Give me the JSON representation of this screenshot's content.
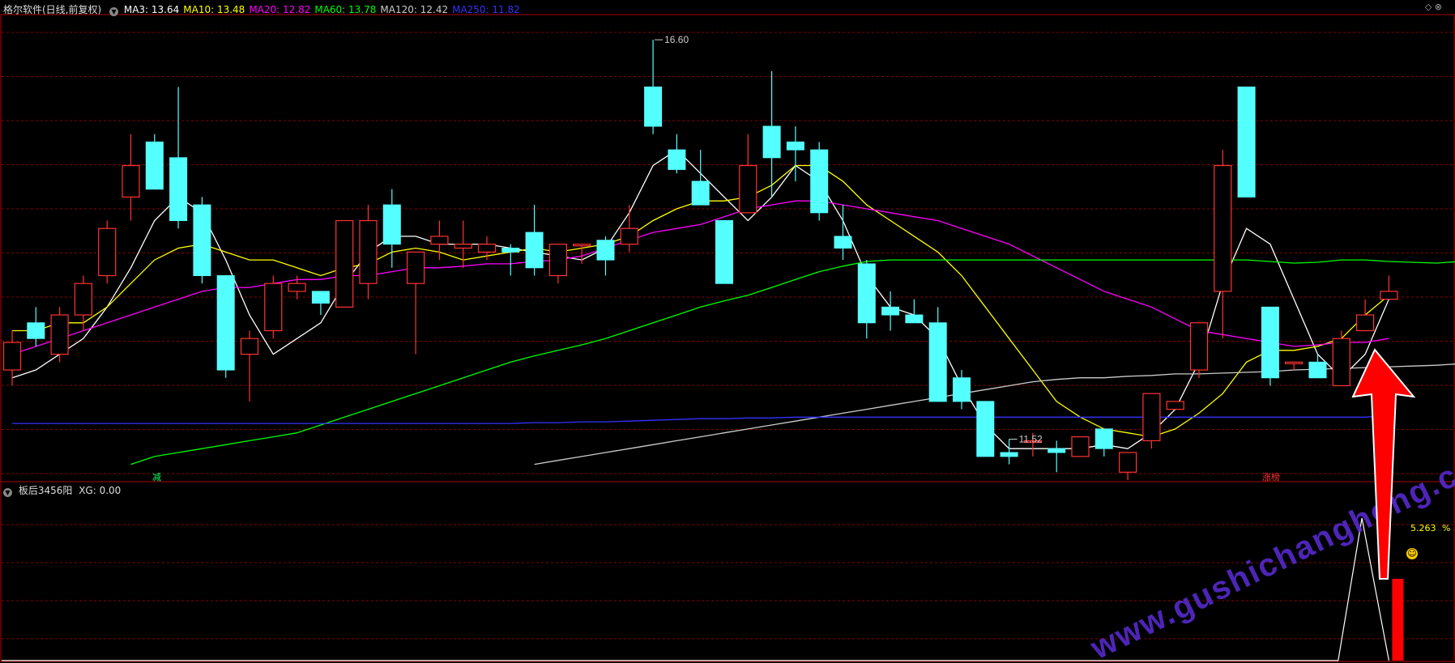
{
  "header": {
    "title": "格尔软件(日线,前复权)",
    "ma": [
      {
        "label": "MA3: 13.64",
        "color": "#ffffff"
      },
      {
        "label": "MA10: 13.48",
        "color": "#ffff00"
      },
      {
        "label": "MA20: 12.82",
        "color": "#ff00ff"
      },
      {
        "label": "MA60: 13.78",
        "color": "#00ff00"
      },
      {
        "label": "MA120: 12.42",
        "color": "#cccccc"
      },
      {
        "label": "MA250: 11.82",
        "color": "#3333ff"
      }
    ]
  },
  "sub_header": {
    "title": "板后3456阳",
    "xg": "XG: 0.00"
  },
  "markers": {
    "jian": "减",
    "zhangting": "涨榜"
  },
  "sub_value": "5.263",
  "sub_unit": "%",
  "watermark": "www.gushichanghong.com",
  "colors": {
    "up": "#ff3333",
    "down": "#54ffff",
    "grid": "#8a0000",
    "border": "#b00000"
  },
  "chart_data": {
    "type": "candlestick",
    "ylim": [
      11.0,
      16.9
    ],
    "annotations": {
      "high": {
        "value": 16.6,
        "label": "16.60"
      },
      "low": {
        "value": 11.52,
        "label": "11.52"
      }
    },
    "candles": [
      [
        12.4,
        12.9,
        12.2,
        12.75
      ],
      [
        13.0,
        13.2,
        12.7,
        12.8
      ],
      [
        12.6,
        13.2,
        12.5,
        13.1
      ],
      [
        13.1,
        13.6,
        12.9,
        13.5
      ],
      [
        13.6,
        14.3,
        13.5,
        14.2
      ],
      [
        14.6,
        15.4,
        14.3,
        15.0
      ],
      [
        15.3,
        15.4,
        14.7,
        14.7
      ],
      [
        15.1,
        16.0,
        14.2,
        14.3
      ],
      [
        14.5,
        14.6,
        13.5,
        13.6
      ],
      [
        13.6,
        13.6,
        12.3,
        12.4
      ],
      [
        12.6,
        12.9,
        12.0,
        12.8
      ],
      [
        12.9,
        13.6,
        12.8,
        13.5
      ],
      [
        13.4,
        13.6,
        13.3,
        13.5
      ],
      [
        13.4,
        13.4,
        13.1,
        13.25
      ],
      [
        13.2,
        14.1,
        13.2,
        14.3
      ],
      [
        13.5,
        14.5,
        13.3,
        14.3
      ],
      [
        14.5,
        14.7,
        13.7,
        14.0
      ],
      [
        13.5,
        13.9,
        12.6,
        13.9
      ],
      [
        14.0,
        14.3,
        13.8,
        14.1
      ],
      [
        13.95,
        14.3,
        13.7,
        14.0
      ],
      [
        13.9,
        14.1,
        13.8,
        14.0
      ],
      [
        13.95,
        14.0,
        13.6,
        13.9
      ],
      [
        14.15,
        14.5,
        13.6,
        13.7
      ],
      [
        13.6,
        14.0,
        13.5,
        14.0
      ],
      [
        14.0,
        14.0,
        13.75,
        14.0
      ],
      [
        14.05,
        14.1,
        13.6,
        13.8
      ],
      [
        14.0,
        14.5,
        13.9,
        14.2
      ],
      [
        16.0,
        16.6,
        15.4,
        15.5
      ],
      [
        15.2,
        15.4,
        14.9,
        14.95
      ],
      [
        14.8,
        15.2,
        14.5,
        14.5
      ],
      [
        14.3,
        14.3,
        13.5,
        13.5
      ],
      [
        14.4,
        15.4,
        14.4,
        15.0
      ],
      [
        15.5,
        16.2,
        14.6,
        15.1
      ],
      [
        15.3,
        15.5,
        14.8,
        15.2
      ],
      [
        15.2,
        15.3,
        14.3,
        14.4
      ],
      [
        14.1,
        14.5,
        13.8,
        13.95
      ],
      [
        13.75,
        13.8,
        12.8,
        13.0
      ],
      [
        13.2,
        13.4,
        12.9,
        13.1
      ],
      [
        13.1,
        13.3,
        13.0,
        13.0
      ],
      [
        13.0,
        13.2,
        12.5,
        12.0
      ],
      [
        12.3,
        12.4,
        11.9,
        12.0
      ],
      [
        12.0,
        12.0,
        11.3,
        11.3
      ],
      [
        11.35,
        11.52,
        11.2,
        11.3
      ],
      [
        11.5,
        11.6,
        11.3,
        11.5
      ],
      [
        11.4,
        11.5,
        11.1,
        11.35
      ],
      [
        11.3,
        11.5,
        11.3,
        11.55
      ],
      [
        11.65,
        11.6,
        11.3,
        11.4
      ],
      [
        11.1,
        11.3,
        11.0,
        11.35
      ],
      [
        11.5,
        12.1,
        11.4,
        12.1
      ],
      [
        11.9,
        12.0,
        11.9,
        12.0
      ],
      [
        12.4,
        13.0,
        12.3,
        13.0
      ],
      [
        13.4,
        15.2,
        12.8,
        15.0
      ],
      [
        16.0,
        16.0,
        14.6,
        14.6
      ],
      [
        13.2,
        13.1,
        12.2,
        12.3
      ],
      [
        12.5,
        12.5,
        12.4,
        12.5
      ],
      [
        12.5,
        12.6,
        12.3,
        12.3
      ],
      [
        12.2,
        12.9,
        12.2,
        12.8
      ],
      [
        12.9,
        13.3,
        12.9,
        13.1
      ],
      [
        13.3,
        13.6,
        13.3,
        13.4
      ]
    ],
    "ma_series": [
      {
        "name": "MA3",
        "color": "#ffffff",
        "values": [
          12.3,
          12.4,
          12.6,
          12.8,
          13.2,
          13.7,
          14.3,
          14.6,
          14.4,
          13.8,
          13.1,
          12.6,
          12.8,
          13.0,
          13.5,
          13.9,
          14.1,
          14.1,
          14.0,
          14.0,
          14.0,
          13.95,
          13.9,
          13.85,
          13.8,
          13.95,
          14.4,
          15.0,
          15.2,
          14.9,
          14.6,
          14.3,
          14.6,
          15.0,
          14.8,
          14.3,
          13.6,
          13.2,
          13.1,
          12.8,
          12.2,
          11.7,
          11.4,
          11.4,
          11.4,
          11.4,
          11.45,
          11.4,
          11.6,
          11.9,
          12.5,
          13.5,
          14.2,
          14.0,
          13.3,
          12.6,
          12.3,
          12.6,
          13.3
        ]
      },
      {
        "name": "MA10",
        "color": "#ffff00",
        "values": [
          12.9,
          12.9,
          13.0,
          13.0,
          13.2,
          13.5,
          13.8,
          13.95,
          14.0,
          13.9,
          13.8,
          13.8,
          13.7,
          13.6,
          13.7,
          13.75,
          13.9,
          13.95,
          13.9,
          13.8,
          13.85,
          13.9,
          13.95,
          13.9,
          13.95,
          14.0,
          14.1,
          14.3,
          14.45,
          14.55,
          14.55,
          14.6,
          14.75,
          15.0,
          15.0,
          14.8,
          14.5,
          14.3,
          14.1,
          13.9,
          13.6,
          13.2,
          12.8,
          12.4,
          12.0,
          11.8,
          11.65,
          11.6,
          11.55,
          11.65,
          11.85,
          12.1,
          12.5,
          12.65,
          12.65,
          12.7,
          12.8,
          13.1,
          13.35
        ]
      },
      {
        "name": "MA20",
        "color": "#ff00ff",
        "values": [
          12.6,
          12.7,
          12.8,
          12.9,
          13.0,
          13.1,
          13.2,
          13.3,
          13.4,
          13.45,
          13.45,
          13.5,
          13.55,
          13.55,
          13.6,
          13.6,
          13.65,
          13.7,
          13.7,
          13.72,
          13.75,
          13.75,
          13.78,
          13.8,
          13.85,
          13.95,
          14.05,
          14.15,
          14.2,
          14.25,
          14.35,
          14.45,
          14.5,
          14.55,
          14.55,
          14.5,
          14.45,
          14.4,
          14.35,
          14.3,
          14.2,
          14.1,
          14.0,
          13.85,
          13.7,
          13.55,
          13.4,
          13.3,
          13.2,
          13.05,
          12.9,
          12.85,
          12.8,
          12.75,
          12.7,
          12.72,
          12.75,
          12.75,
          12.8
        ]
      },
      {
        "name": "MA60",
        "color": "#00ff00",
        "startIndex": 5,
        "values": [
          11.2,
          11.3,
          11.35,
          11.4,
          11.45,
          11.5,
          11.55,
          11.6,
          11.7,
          11.8,
          11.9,
          12.0,
          12.1,
          12.2,
          12.3,
          12.4,
          12.5,
          12.58,
          12.65,
          12.72,
          12.8,
          12.9,
          13.0,
          13.1,
          13.2,
          13.28,
          13.35,
          13.45,
          13.55,
          13.65,
          13.72,
          13.78,
          13.8,
          13.8,
          13.8,
          13.8,
          13.8,
          13.8,
          13.8,
          13.8,
          13.8,
          13.8,
          13.8,
          13.8,
          13.8,
          13.8,
          13.8,
          13.8,
          13.78,
          13.76,
          13.77,
          13.8,
          13.8,
          13.78,
          13.77,
          13.76,
          13.78
        ]
      },
      {
        "name": "MA120",
        "color": "#cccccc",
        "startIndex": 22,
        "values": [
          11.2,
          11.25,
          11.3,
          11.35,
          11.4,
          11.45,
          11.5,
          11.55,
          11.6,
          11.65,
          11.7,
          11.75,
          11.8,
          11.85,
          11.9,
          11.95,
          12.0,
          12.05,
          12.1,
          12.15,
          12.2,
          12.25,
          12.28,
          12.3,
          12.3,
          12.32,
          12.33,
          12.35,
          12.35,
          12.36,
          12.37,
          12.38,
          12.4,
          12.41,
          12.42,
          12.43,
          12.44,
          12.45,
          12.46,
          12.48
        ]
      },
      {
        "name": "MA250",
        "color": "#3333ff",
        "values": [
          11.72,
          11.72,
          11.72,
          11.72,
          11.72,
          11.72,
          11.72,
          11.72,
          11.72,
          11.72,
          11.72,
          11.72,
          11.72,
          11.72,
          11.72,
          11.72,
          11.72,
          11.72,
          11.72,
          11.72,
          11.72,
          11.72,
          11.73,
          11.73,
          11.74,
          11.74,
          11.75,
          11.76,
          11.77,
          11.78,
          11.78,
          11.79,
          11.79,
          11.8,
          11.8,
          11.8,
          11.8,
          11.8,
          11.8,
          11.8,
          11.8,
          11.8,
          11.8,
          11.8,
          11.8,
          11.8,
          11.8,
          11.8,
          11.8,
          11.8,
          11.8,
          11.8,
          11.8,
          11.8,
          11.8,
          11.8,
          11.8,
          11.8,
          11.82
        ]
      }
    ],
    "sub": {
      "bar_value": 5.263
    }
  }
}
